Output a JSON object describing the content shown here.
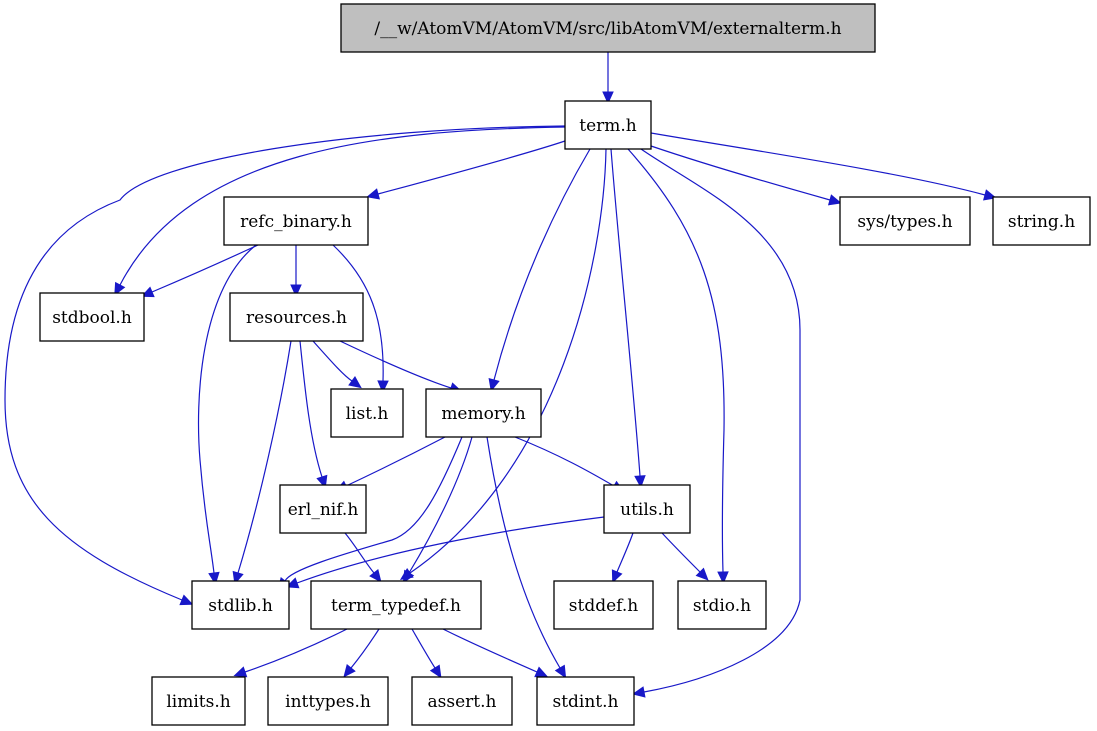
{
  "diagram": {
    "type": "include-dependency-graph",
    "edge_color": "#1818c8",
    "root_fill": "#bfbfbf",
    "nodes": [
      {
        "id": "externalterm",
        "label": "/__w/AtomVM/AtomVM/src/libAtomVM/externalterm.h",
        "root": true
      },
      {
        "id": "term",
        "label": "term.h"
      },
      {
        "id": "refc_binary",
        "label": "refc_binary.h"
      },
      {
        "id": "sys_types",
        "label": "sys/types.h"
      },
      {
        "id": "string",
        "label": "string.h"
      },
      {
        "id": "stdbool",
        "label": "stdbool.h"
      },
      {
        "id": "resources",
        "label": "resources.h"
      },
      {
        "id": "list",
        "label": "list.h"
      },
      {
        "id": "memory",
        "label": "memory.h"
      },
      {
        "id": "erl_nif",
        "label": "erl_nif.h"
      },
      {
        "id": "utils",
        "label": "utils.h"
      },
      {
        "id": "stdlib",
        "label": "stdlib.h"
      },
      {
        "id": "term_typedef",
        "label": "term_typedef.h"
      },
      {
        "id": "stddef",
        "label": "stddef.h"
      },
      {
        "id": "stdio",
        "label": "stdio.h"
      },
      {
        "id": "limits",
        "label": "limits.h"
      },
      {
        "id": "inttypes",
        "label": "inttypes.h"
      },
      {
        "id": "assert",
        "label": "assert.h"
      },
      {
        "id": "stdint",
        "label": "stdint.h"
      }
    ],
    "edges": [
      {
        "from": "externalterm",
        "to": "term"
      },
      {
        "from": "term",
        "to": "refc_binary"
      },
      {
        "from": "term",
        "to": "sys_types"
      },
      {
        "from": "term",
        "to": "string"
      },
      {
        "from": "term",
        "to": "stdbool"
      },
      {
        "from": "term",
        "to": "stdlib"
      },
      {
        "from": "term",
        "to": "memory"
      },
      {
        "from": "term",
        "to": "term_typedef"
      },
      {
        "from": "term",
        "to": "utils"
      },
      {
        "from": "term",
        "to": "stdio"
      },
      {
        "from": "term",
        "to": "stdint"
      },
      {
        "from": "refc_binary",
        "to": "stdbool"
      },
      {
        "from": "refc_binary",
        "to": "resources"
      },
      {
        "from": "refc_binary",
        "to": "list"
      },
      {
        "from": "refc_binary",
        "to": "stdlib"
      },
      {
        "from": "resources",
        "to": "list"
      },
      {
        "from": "resources",
        "to": "memory"
      },
      {
        "from": "resources",
        "to": "erl_nif"
      },
      {
        "from": "resources",
        "to": "stdlib"
      },
      {
        "from": "memory",
        "to": "erl_nif"
      },
      {
        "from": "memory",
        "to": "utils"
      },
      {
        "from": "memory",
        "to": "stdlib"
      },
      {
        "from": "memory",
        "to": "term_typedef"
      },
      {
        "from": "memory",
        "to": "stdint"
      },
      {
        "from": "erl_nif",
        "to": "term_typedef"
      },
      {
        "from": "utils",
        "to": "stdlib"
      },
      {
        "from": "utils",
        "to": "stddef"
      },
      {
        "from": "utils",
        "to": "stdio"
      },
      {
        "from": "term_typedef",
        "to": "limits"
      },
      {
        "from": "term_typedef",
        "to": "inttypes"
      },
      {
        "from": "term_typedef",
        "to": "assert"
      },
      {
        "from": "term_typedef",
        "to": "stdint"
      }
    ]
  }
}
